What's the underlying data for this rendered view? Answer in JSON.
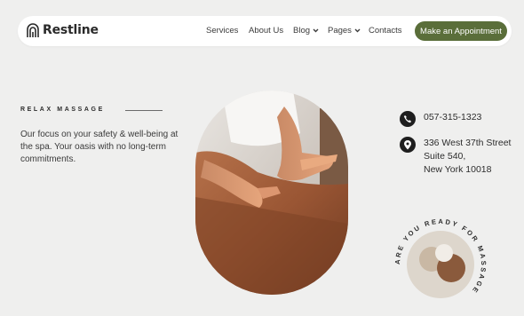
{
  "brand": {
    "name": "Restline",
    "logo_icon": "spa-arches-logo",
    "accent_color": "#5a6e3a"
  },
  "nav": {
    "items": [
      {
        "label": "Services",
        "has_dropdown": false
      },
      {
        "label": "About Us",
        "has_dropdown": false
      },
      {
        "label": "Blog",
        "has_dropdown": true
      },
      {
        "label": "Pages",
        "has_dropdown": true
      },
      {
        "label": "Contacts",
        "has_dropdown": false
      }
    ],
    "cta_label": "Make an Appointment"
  },
  "hero": {
    "eyebrow": "RELAX MASSAGE",
    "description": "Our focus on your safety & well-being at the spa. Your oasis with no long-term commitments.",
    "image": "back-massage-photo"
  },
  "contact": {
    "phone": "057-315-1323",
    "phone_icon": "phone-icon",
    "address_lines": [
      "336 West 37th Street",
      "Suite 540,",
      "New York 10018"
    ],
    "address_icon": "location-pin-icon"
  },
  "badge": {
    "text": "ARE YOU READY FOR MASSAGE"
  }
}
